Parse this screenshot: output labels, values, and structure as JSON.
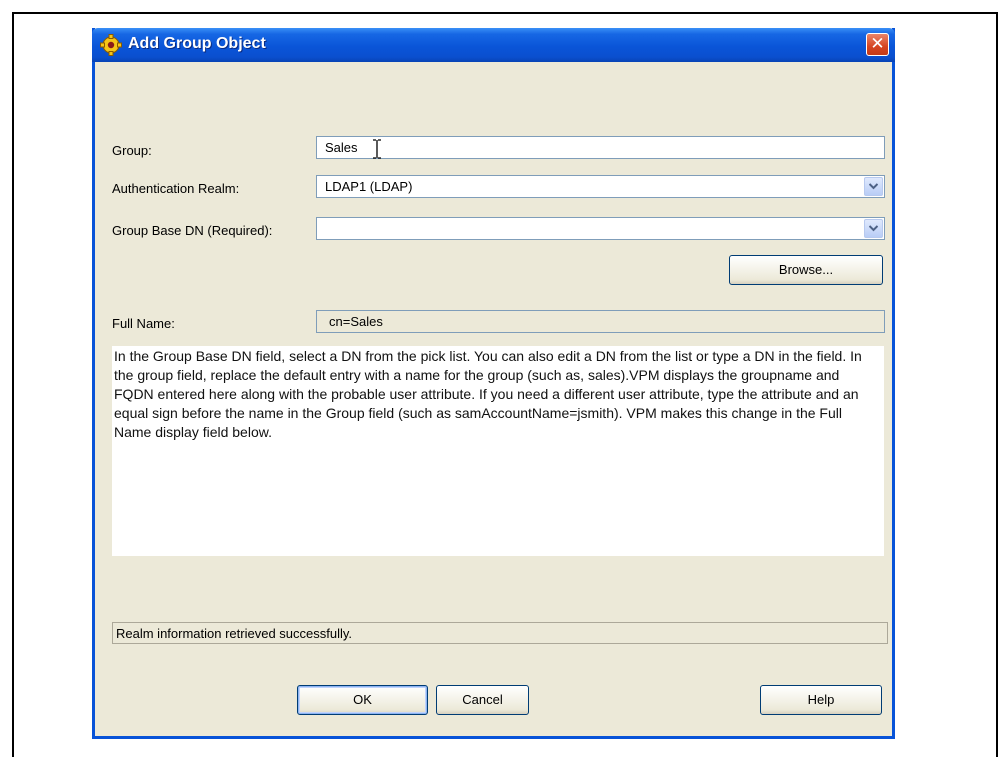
{
  "dialog": {
    "title": "Add Group Object",
    "close_label": "✕"
  },
  "form": {
    "group_label": "Group:",
    "group_value": "Sales",
    "realm_label": "Authentication Realm:",
    "realm_value": "LDAP1 (LDAP)",
    "base_dn_label": "Group Base DN (Required):",
    "base_dn_value": "",
    "browse_label": "Browse...",
    "full_name_label": "Full Name:",
    "full_name_value": "cn=Sales"
  },
  "help_text": "In the Group Base DN field, select a DN from the pick list. You can also edit a DN from the list or type a DN in the field. In the group field, replace the default entry with a name for the group (such as, sales).VPM displays the groupname and FQDN entered here along with the probable user attribute. If you need a different user attribute, type the attribute and an equal sign before the name in the Group field (such as samAccountName=jsmith). VPM makes this change in the Full Name display field below.",
  "status": "Realm information retrieved successfully.",
  "buttons": {
    "ok": "OK",
    "cancel": "Cancel",
    "help": "Help"
  },
  "colors": {
    "titlebar": "#0a55d8",
    "dialog_bg": "#ece9d8",
    "close": "#d64521"
  },
  "icons": {
    "title": "gear-icon",
    "combo": "chevron-down-icon",
    "cursor": "text-cursor-icon"
  }
}
